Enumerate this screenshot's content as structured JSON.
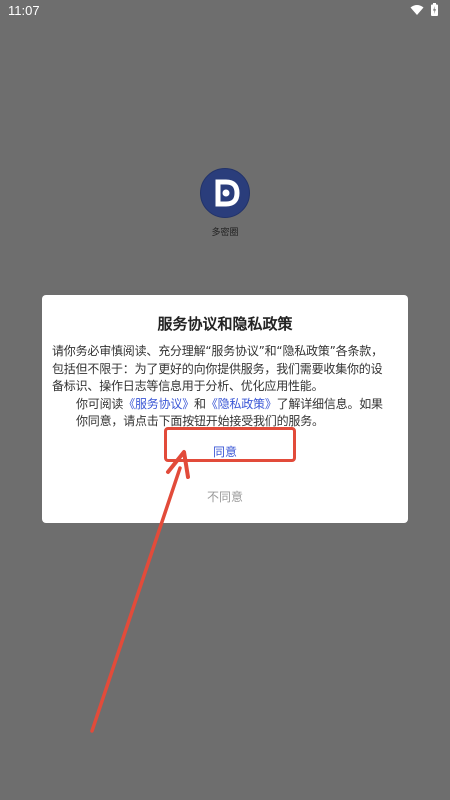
{
  "statusbar": {
    "time": "11:07"
  },
  "app": {
    "name": "多密圈"
  },
  "dialog": {
    "title": "服务协议和隐私政策",
    "para1": "请你务必审慎阅读、充分理解“服务协议”和“隐私政策”各条款，包括但不限于：为了更好的向你提供服务，我们需要收集你的设备标识、操作日志等信息用于分析、优化应用性能。",
    "para2_pre": "你可阅读",
    "link_service": "《服务协议》",
    "para2_and": "和",
    "link_privacy": "《隐私政策》",
    "para2_post": "了解详细信息。如果你同意，请点击下面按钮开始接受我们的服务。",
    "agree_label": "同意",
    "disagree_label": "不同意"
  },
  "colors": {
    "overlay": "#6e6e6e",
    "accent": "#3b57d6",
    "highlight": "#e24b3a",
    "logo": "#2a3d7b"
  }
}
